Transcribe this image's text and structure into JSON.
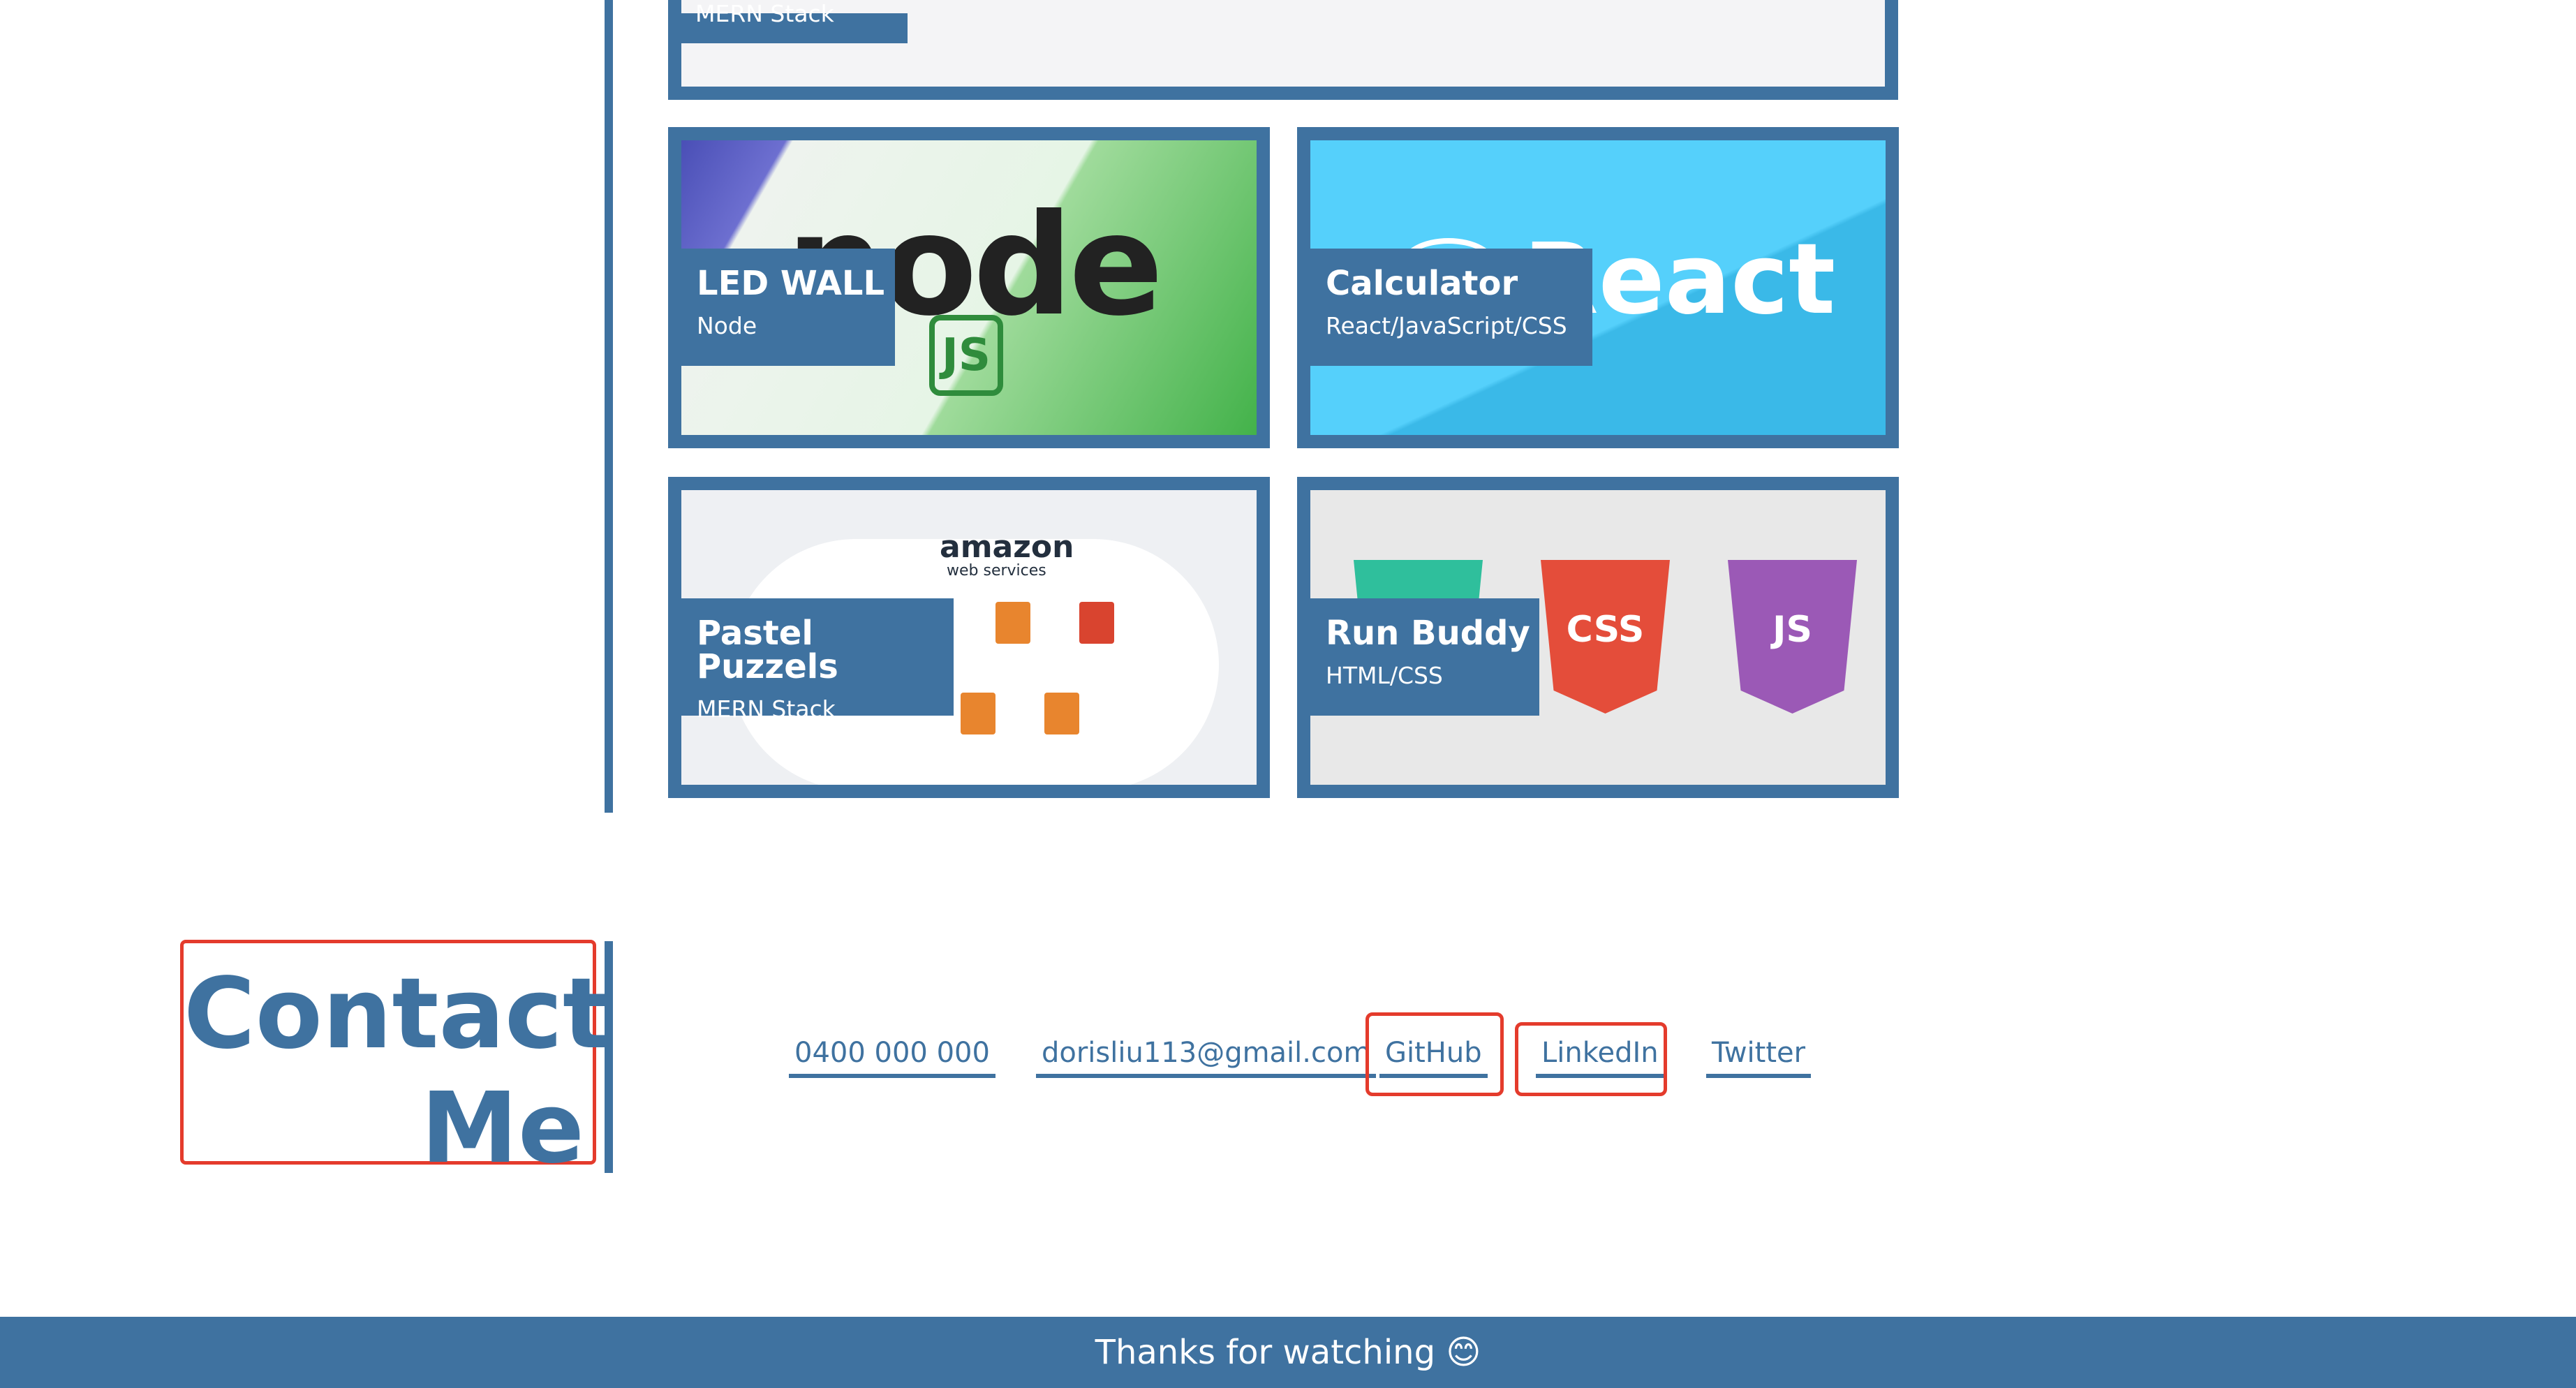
{
  "projects": {
    "top": {
      "tech": "MERN Stack"
    },
    "led_wall": {
      "title": "LED WALL",
      "tech": "Node"
    },
    "calculator": {
      "title": "Calculator",
      "tech": "React/JavaScript/CSS"
    },
    "pastel_puzzels": {
      "title": "Pastel Puzzels",
      "tech": "MERN Stack"
    },
    "run_buddy": {
      "title": "Run Buddy",
      "tech": "HTML/CSS"
    }
  },
  "artwork": {
    "node_word": "node",
    "node_js": "JS",
    "react_word": "React",
    "aws_word": "amazon",
    "aws_sub": "web services",
    "shield_css": "CSS",
    "shield_js": "JS"
  },
  "contact": {
    "heading_line1": "Contact",
    "heading_line2": "Me",
    "phone": "0400 000 000",
    "email": "dorisliu113@gmail.com",
    "github": "GitHub",
    "linkedin": "LinkedIn",
    "twitter": "Twitter"
  },
  "footer": {
    "text": "Thanks for watching 😊"
  },
  "colors": {
    "accent": "#3f72a0",
    "highlight": "#e43b2c"
  }
}
